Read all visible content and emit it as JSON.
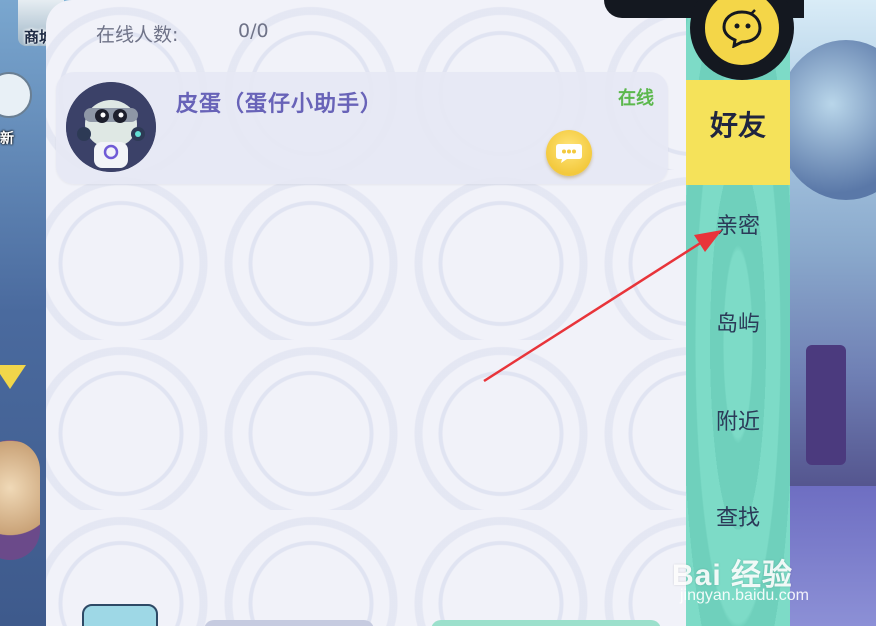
{
  "hud": {
    "shop_label": "商城",
    "new_label": "新"
  },
  "panel": {
    "online_label": "在线人数:",
    "online_count": "0/0"
  },
  "friends": [
    {
      "name": "皮蛋（蛋仔小助手）",
      "status": "在线",
      "status_color": "#5cb84d"
    }
  ],
  "tabs": {
    "active": "好友",
    "items": [
      "亲密",
      "岛屿",
      "附近",
      "查找"
    ]
  },
  "watermark": {
    "brand": "Bai 经验",
    "url": "jingyan.baidu.com"
  },
  "colors": {
    "tab_active": "#f5e25a",
    "tabbar": "#7ddbc7",
    "name": "#6863b8",
    "arrow": "#e8343a"
  }
}
